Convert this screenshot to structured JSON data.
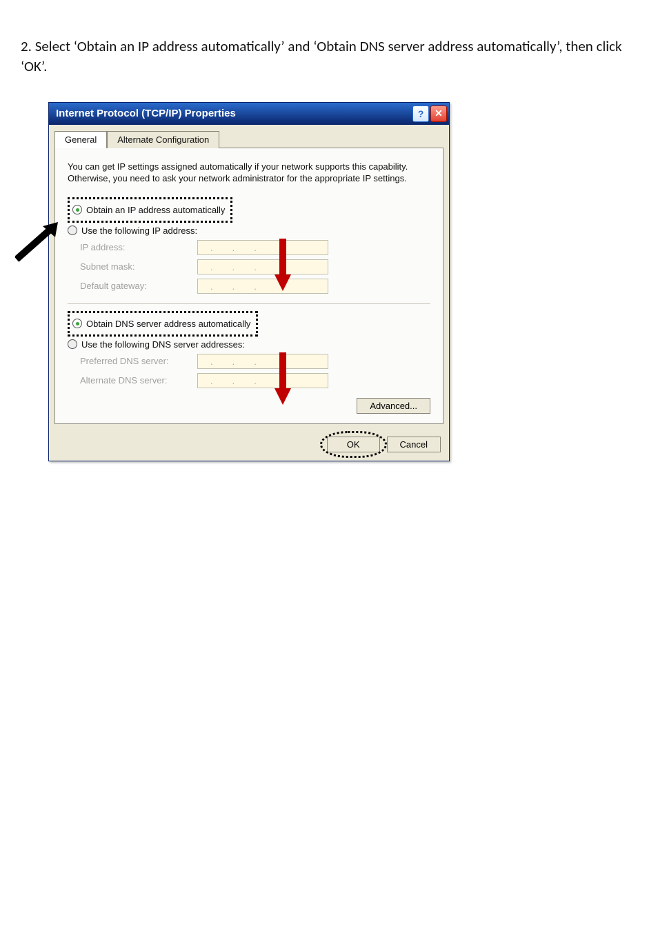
{
  "instruction": "2. Select ‘Obtain an IP address automatically’ and ‘Obtain DNS server address automatically’, then click ‘OK’.",
  "dialog": {
    "title": "Internet Protocol (TCP/IP) Properties",
    "help_glyph": "?",
    "close_glyph": "✕",
    "tabs": {
      "general": "General",
      "alt": "Alternate Configuration"
    },
    "description": "You can get IP settings assigned automatically if your network supports this capability. Otherwise, you need to ask your network administrator for the appropriate IP settings.",
    "ip": {
      "obtain": "Obtain an IP address automatically",
      "use": "Use the following IP address:",
      "address_label": "IP address:",
      "subnet_label": "Subnet mask:",
      "gateway_label": "Default gateway:"
    },
    "dns": {
      "obtain": "Obtain DNS server address automatically",
      "use": "Use the following DNS server addresses:",
      "preferred_label": "Preferred DNS server:",
      "alternate_label": "Alternate DNS server:"
    },
    "buttons": {
      "advanced": "Advanced...",
      "ok": "OK",
      "cancel": "Cancel"
    }
  }
}
